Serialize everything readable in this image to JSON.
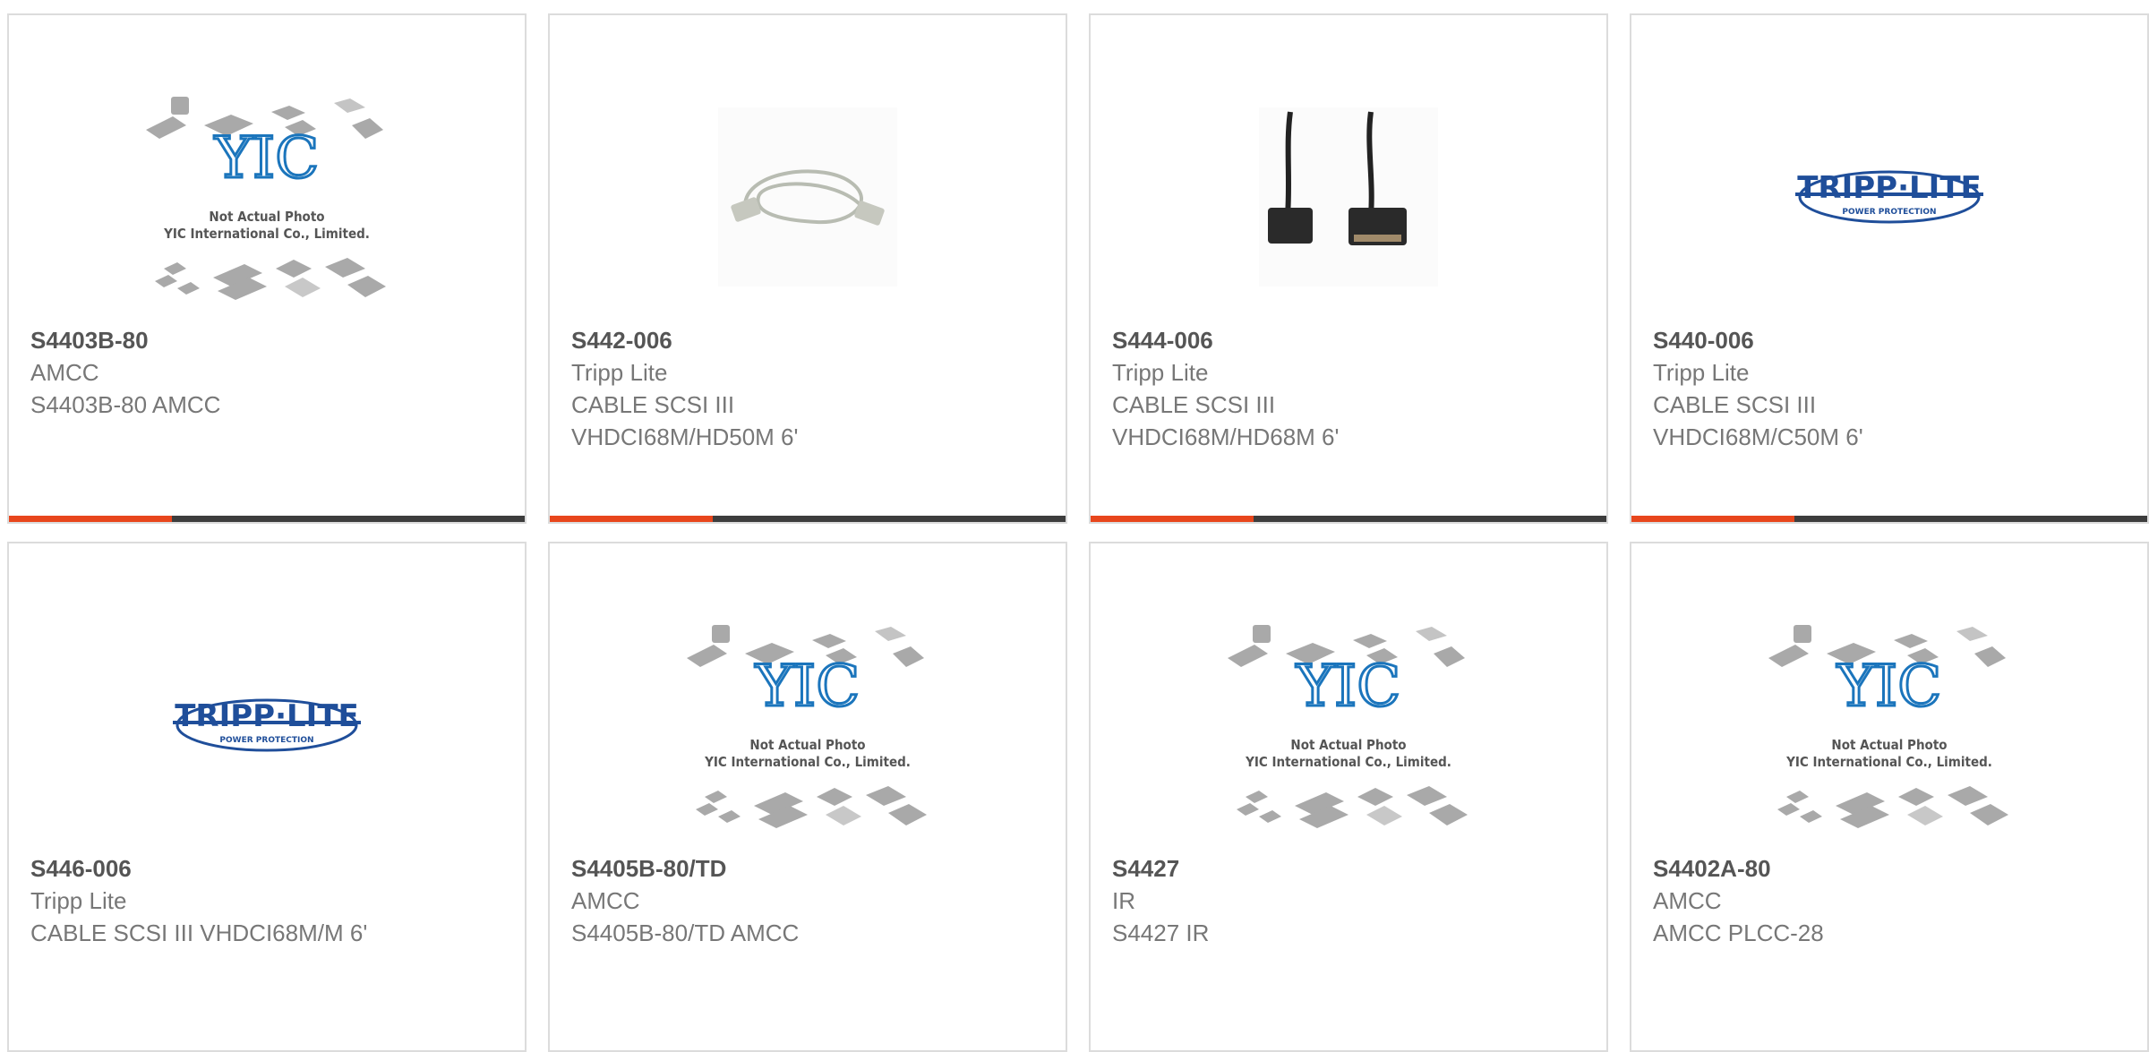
{
  "accent_color": "#e8461c",
  "products": [
    {
      "part": "S4403B-80",
      "manufacturer": "AMCC",
      "description": "S4403B-80 AMCC",
      "image": "yic-placeholder-icon"
    },
    {
      "part": "S442-006",
      "manufacturer": "Tripp Lite",
      "description": "CABLE SCSI III\nVHDCI68M/HD50M 6'",
      "image": "gray-cable-icon"
    },
    {
      "part": "S444-006",
      "manufacturer": "Tripp Lite",
      "description": "CABLE SCSI III\nVHDCI68M/HD68M 6'",
      "image": "black-cable-icon"
    },
    {
      "part": "S440-006",
      "manufacturer": "Tripp Lite",
      "description": "CABLE SCSI III\nVHDCI68M/C50M 6'",
      "image": "tripp-lite-logo"
    },
    {
      "part": "S446-006",
      "manufacturer": "Tripp Lite",
      "description": "CABLE SCSI III VHDCI68M/M 6'",
      "image": "tripp-lite-logo"
    },
    {
      "part": "S4405B-80/TD",
      "manufacturer": "AMCC",
      "description": "S4405B-80/TD AMCC",
      "image": "yic-placeholder-icon"
    },
    {
      "part": "S4427",
      "manufacturer": "IR",
      "description": "S4427 IR",
      "image": "yic-placeholder-icon"
    },
    {
      "part": "S4402A-80",
      "manufacturer": "AMCC",
      "description": "AMCC PLCC-28",
      "image": "yic-placeholder-icon"
    }
  ],
  "placeholder": {
    "line1": "Not Actual Photo",
    "line2": "YIC International Co., Limited.",
    "brand": "YIC"
  },
  "tripp_logo": {
    "brand": "TRIPP·LITE",
    "tagline": "POWER PROTECTION"
  }
}
